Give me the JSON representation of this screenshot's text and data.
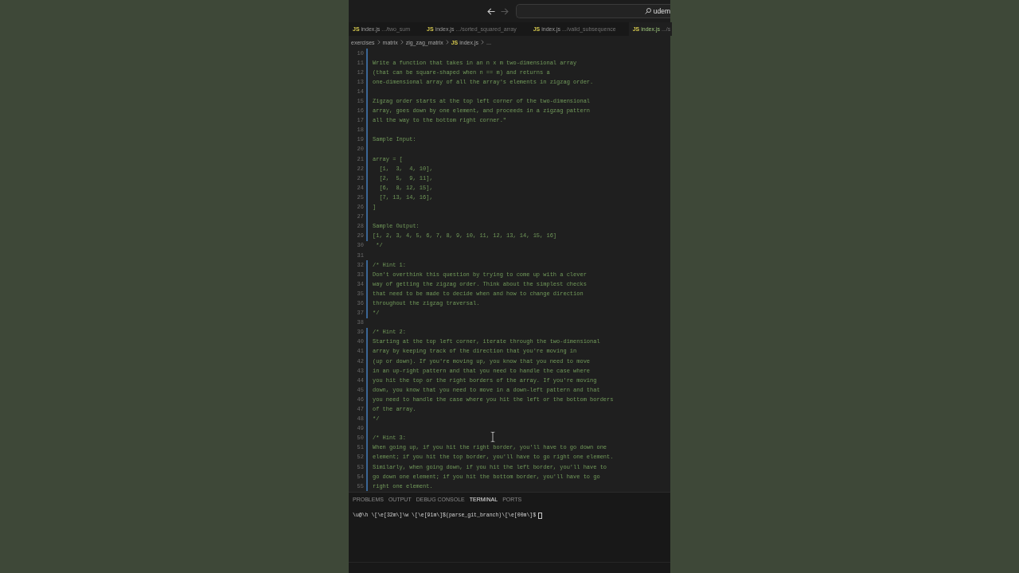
{
  "title_bar": {
    "nav_buttons": [
      {
        "kind": "back",
        "disabled": false
      },
      {
        "kind": "forward",
        "disabled": true
      }
    ],
    "search": {
      "text": "udem"
    }
  },
  "tabs": [
    {
      "icon": "JS",
      "label": "index.js",
      "path": ".../two_sum",
      "selected": false
    },
    {
      "icon": "JS",
      "label": "index.js",
      "path": ".../sorted_squared_array",
      "selected": false
    },
    {
      "icon": "JS",
      "label": "index.js",
      "path": ".../valid_subsequence",
      "selected": false
    },
    {
      "icon": "JS",
      "label": "index.js",
      "path": ".../s",
      "selected": true
    }
  ],
  "breadcrumb": [
    {
      "label": "exercises"
    },
    {
      "label": "matrix"
    },
    {
      "label": "zig_zag_matrix"
    },
    {
      "icon": "JS",
      "label": "index.js"
    },
    {
      "label": "..."
    }
  ],
  "editor": {
    "lines": [
      {
        "number": "10",
        "changed": true
      },
      {
        "number": "11",
        "text": "Write a function that takes in an n x m two-dimensional array",
        "changed": true
      },
      {
        "number": "12",
        "text": "(that can be square-shaped when n == m) and returns a",
        "changed": true
      },
      {
        "number": "13",
        "text": "one-dimensional array of all the array's elements in zigzag order.",
        "changed": true
      },
      {
        "number": "14",
        "changed": true
      },
      {
        "number": "15",
        "text": "Zigzag order starts at the top left corner of the two-dimensional",
        "changed": true
      },
      {
        "number": "16",
        "text": "array, goes down by one element, and proceeds in a zigzag pattern",
        "changed": true
      },
      {
        "number": "17",
        "text": "all the way to the bottom right corner.\"",
        "changed": true
      },
      {
        "number": "18",
        "changed": true
      },
      {
        "number": "19",
        "text": "Sample Input:",
        "changed": true
      },
      {
        "number": "20",
        "changed": true
      },
      {
        "number": "21",
        "text": "array = [",
        "changed": true
      },
      {
        "number": "22",
        "text": "  [1,  3,  4, 10],",
        "changed": true
      },
      {
        "number": "23",
        "text": "  [2,  5,  9, 11],",
        "changed": true
      },
      {
        "number": "24",
        "text": "  [6,  8, 12, 15],",
        "changed": true
      },
      {
        "number": "25",
        "text": "  [7, 13, 14, 16],",
        "changed": true
      },
      {
        "number": "26",
        "text": "]",
        "changed": true
      },
      {
        "number": "27",
        "changed": true
      },
      {
        "number": "28",
        "text": "Sample Output:",
        "changed": true
      },
      {
        "number": "29",
        "text": "[1, 2, 3, 4, 5, 6, 7, 8, 9, 10, 11, 12, 13, 14, 15, 16]",
        "changed": true
      },
      {
        "number": "30",
        "text": " */",
        "changed": false
      },
      {
        "number": "31",
        "changed": false
      },
      {
        "number": "32",
        "text": "/* Hint 1:",
        "changed": true
      },
      {
        "number": "33",
        "text": "Don't overthink this question by trying to come up with a clever",
        "changed": true
      },
      {
        "number": "34",
        "text": "way of getting the zigzag order. Think about the simplest checks",
        "changed": true
      },
      {
        "number": "35",
        "text": "that need to be made to decide when and how to change direction",
        "changed": true
      },
      {
        "number": "36",
        "text": "throughout the zigzag traversal.",
        "changed": true
      },
      {
        "number": "37",
        "text": "*/",
        "changed": true
      },
      {
        "number": "38",
        "changed": false
      },
      {
        "number": "39",
        "text": "/* Hint 2:",
        "changed": true
      },
      {
        "number": "40",
        "text": "Starting at the top left corner, iterate through the two-dimensional",
        "changed": true
      },
      {
        "number": "41",
        "text": "array by keeping track of the direction that you're moving in",
        "changed": true
      },
      {
        "number": "42",
        "text": "(up or down). If you're moving up, you know that you need to move",
        "changed": true
      },
      {
        "number": "43",
        "text": "in an up-right pattern and that you need to handle the case where",
        "changed": true
      },
      {
        "number": "44",
        "text": "you hit the top or the right borders of the array. If you're moving",
        "changed": true
      },
      {
        "number": "45",
        "text": "down, you know that you need to move in a down-left pattern and that",
        "changed": true
      },
      {
        "number": "46",
        "text": "you need to handle the case where you hit the left or the bottom borders",
        "changed": true
      },
      {
        "number": "47",
        "text": "of the array.",
        "changed": true
      },
      {
        "number": "48",
        "text": "*/",
        "changed": true
      },
      {
        "number": "49",
        "changed": true
      },
      {
        "number": "50",
        "text": "/* Hint 3:",
        "changed": true
      },
      {
        "number": "51",
        "text": "When going up, if you hit the right border, you'll have to go down one",
        "changed": true
      },
      {
        "number": "52",
        "text": "element; if you hit the top border, you'll have to go right one element.",
        "changed": true
      },
      {
        "number": "53",
        "text": "Similarly, when going down, if you hit the left border, you'll have to",
        "changed": true
      },
      {
        "number": "54",
        "text": "go down one element; if you hit the bottom border, you'll have to go",
        "changed": true
      },
      {
        "number": "55",
        "text": "right one element.",
        "changed": true
      }
    ]
  },
  "panel": {
    "tabs": [
      {
        "label": "PROBLEMS",
        "selected": false
      },
      {
        "label": "OUTPUT",
        "selected": false
      },
      {
        "label": "DEBUG CONSOLE",
        "selected": false
      },
      {
        "label": "TERMINAL",
        "selected": true
      },
      {
        "label": "PORTS",
        "selected": false
      }
    ],
    "terminal": {
      "prompt": "\\u@\\h \\[\\e[32m\\]\\w \\[\\e[91m\\]$(parse_git_branch)\\[\\e[00m\\]$"
    }
  }
}
